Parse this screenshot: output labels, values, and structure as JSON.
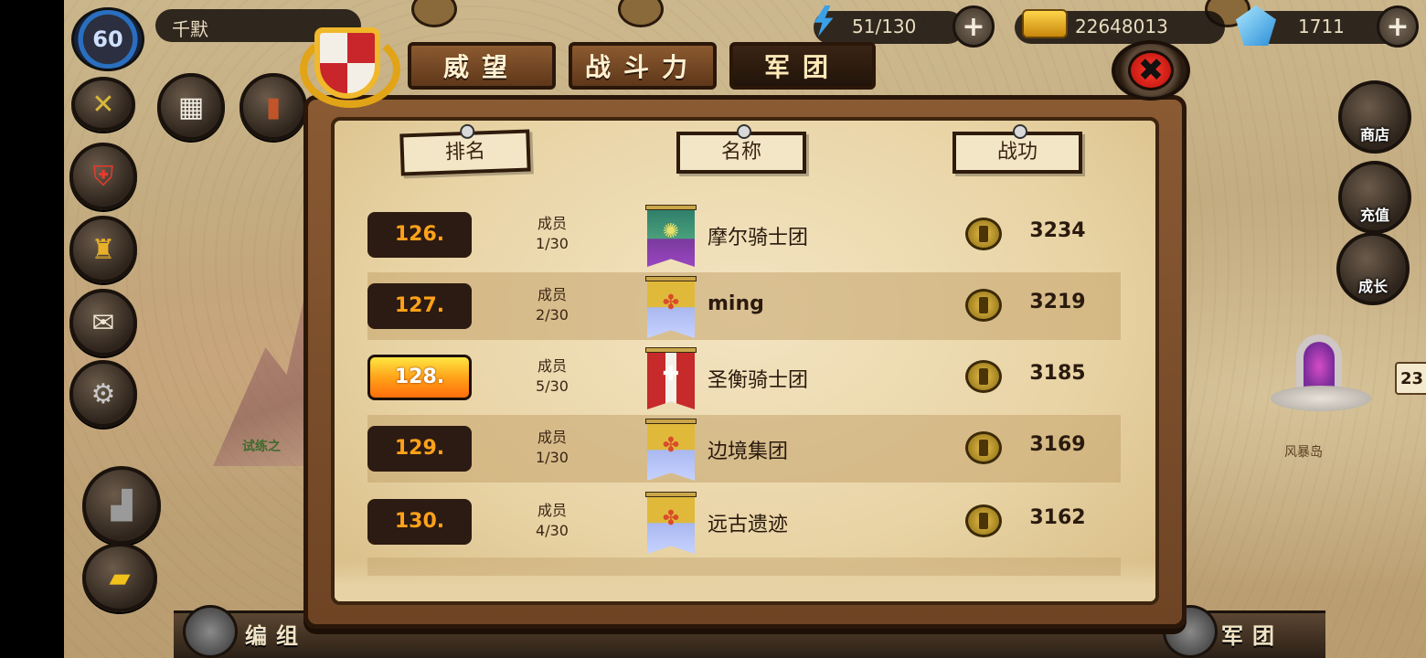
{
  "player": {
    "level": "60",
    "name": "千默"
  },
  "resources": {
    "energy": "51/130",
    "gold": "22648013",
    "gems": "1711"
  },
  "tabs": [
    {
      "label": "威望"
    },
    {
      "label": "战斗力"
    },
    {
      "label": "军团"
    }
  ],
  "table": {
    "headers": {
      "rank": "排名",
      "name": "名称",
      "merit": "战功"
    },
    "rows": [
      {
        "rank": "126.",
        "members_label": "成员",
        "members": "1/30",
        "name": "摩尔骑士团",
        "merit": "3234",
        "banner_color": "#7b3a9e",
        "highlight": false
      },
      {
        "rank": "127.",
        "members_label": "成员",
        "members": "2/30",
        "name": "ming",
        "merit": "3219",
        "banner_color": "#e0b93a",
        "highlight": false
      },
      {
        "rank": "128.",
        "members_label": "成员",
        "members": "5/30",
        "name": "圣衡骑士团",
        "merit": "3185",
        "banner_color": "#c62a2a",
        "highlight": true
      },
      {
        "rank": "129.",
        "members_label": "成员",
        "members": "1/30",
        "name": "边境集团",
        "merit": "3169",
        "banner_color": "#e0b93a",
        "highlight": false
      },
      {
        "rank": "130.",
        "members_label": "成员",
        "members": "4/30",
        "name": "远古遗迹",
        "merit": "3162",
        "banner_color": "#e0b93a",
        "highlight": false
      }
    ]
  },
  "side_buttons": {
    "shop": "商店",
    "recharge": "充值",
    "growth": "成长"
  },
  "bottom": {
    "formation": "编组",
    "legion": "军团"
  },
  "map": {
    "island": "风暴岛",
    "trial": "试练之",
    "side_number": "23"
  },
  "icons": {
    "close": "✖"
  },
  "colors": {
    "rank_text": "#ffa21a",
    "highlight_badge": "#ff9d16",
    "close_red": "#e8231a"
  }
}
